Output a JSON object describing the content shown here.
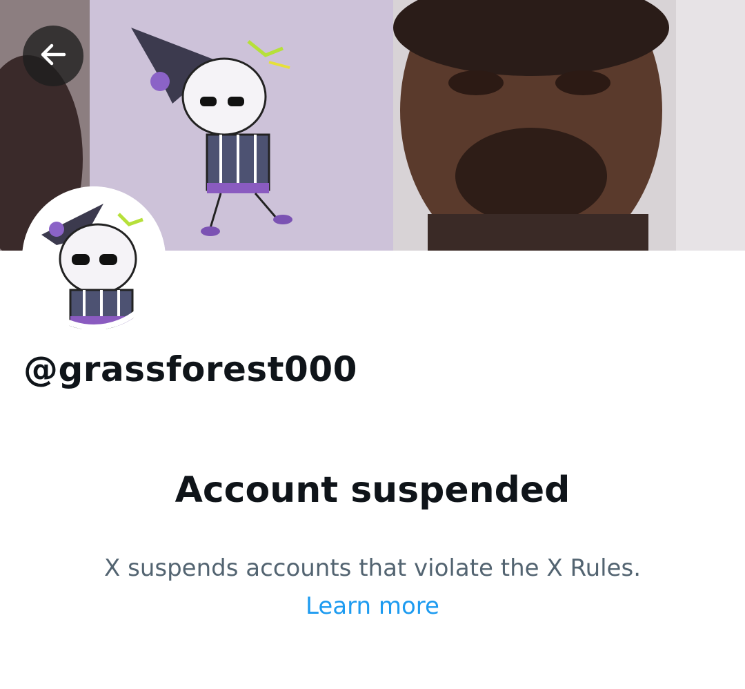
{
  "profile": {
    "handle": "@grassforest000",
    "banner_description": "banner-image",
    "avatar_description": "avatar-image"
  },
  "suspension": {
    "title": "Account suspended",
    "description": "X suspends accounts that violate the X Rules.",
    "link_label": "Learn more"
  },
  "icons": {
    "back": "arrow-left-icon"
  },
  "colors": {
    "text_primary": "#0f1419",
    "text_secondary": "#536471",
    "link": "#1d9bf0",
    "banner_panel": "#cdc2d9"
  }
}
